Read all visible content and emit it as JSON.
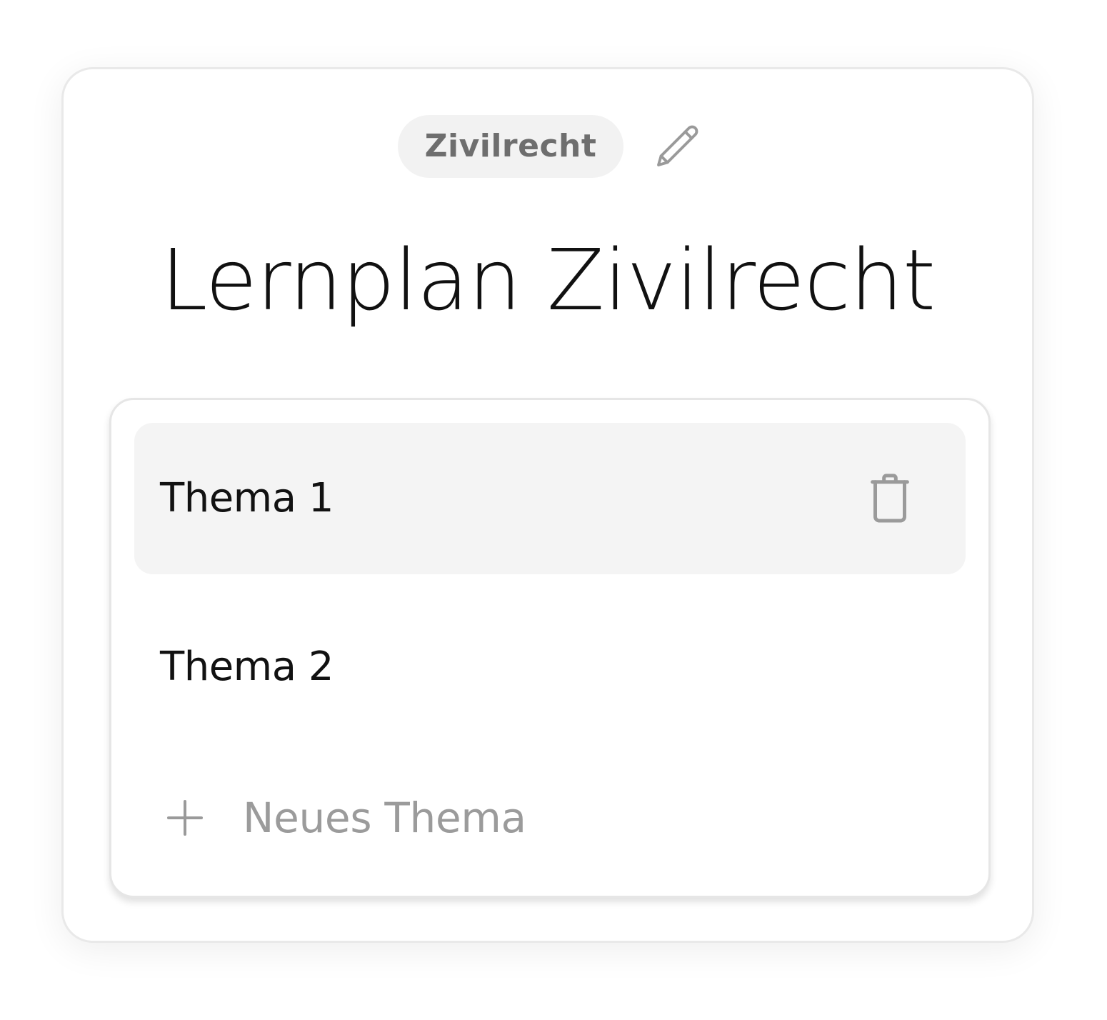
{
  "header": {
    "subject_badge": "Zivilrecht",
    "edit_icon": "pencil-icon",
    "title": "Lernplan Zivilrecht"
  },
  "topics": [
    {
      "label": "Thema 1",
      "active": true,
      "action_icon": "trash-icon"
    },
    {
      "label": "Thema 2",
      "active": false
    }
  ],
  "add_topic": {
    "icon": "plus-icon",
    "label": "Neues Thema"
  },
  "colors": {
    "badge_background": "#f2f2f2",
    "badge_text": "#6e6e6e",
    "active_row_background": "#f4f4f4",
    "muted_text": "#9b9b9b",
    "icon_gray": "#9a9a9a",
    "border": "#e9e9e9"
  }
}
